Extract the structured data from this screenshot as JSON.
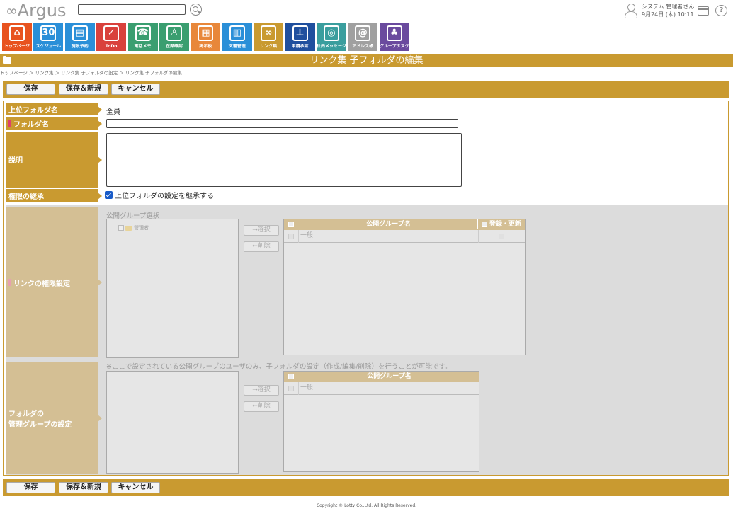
{
  "header": {
    "logo_text": "Argus",
    "logo_mark": "∞",
    "search": {
      "value": "",
      "placeholder": ""
    },
    "user": {
      "name": "システム 管理者さん",
      "datetime": "9月24日 (木) 10:11"
    }
  },
  "apps": [
    {
      "label": "トップページ",
      "color": "#e8531f",
      "icon": "home-icon",
      "glyph": "⌂"
    },
    {
      "label": "スケジュール",
      "color": "#2a8fd8",
      "icon": "calendar-icon",
      "glyph": "30"
    },
    {
      "label": "施設予約",
      "color": "#2a8fd8",
      "icon": "facility-icon",
      "glyph": "▤"
    },
    {
      "label": "ToDo",
      "color": "#d9413c",
      "icon": "todo-icon",
      "glyph": "✓"
    },
    {
      "label": "電話メモ",
      "color": "#3a9e70",
      "icon": "phone-icon",
      "glyph": "☎"
    },
    {
      "label": "在席確認",
      "color": "#3a9e70",
      "icon": "presence-icon",
      "glyph": "♙"
    },
    {
      "label": "掲示板",
      "color": "#e8873a",
      "icon": "board-icon",
      "glyph": "▦"
    },
    {
      "label": "文書管理",
      "color": "#2a8fd8",
      "icon": "document-icon",
      "glyph": "▥"
    },
    {
      "label": "リンク集",
      "color": "#c99a30",
      "icon": "link-icon",
      "glyph": "∞"
    },
    {
      "label": "申請承認",
      "color": "#1f4f9e",
      "icon": "approval-icon",
      "glyph": "⊥"
    },
    {
      "label": "社内メッセージ",
      "color": "#3a9e9e",
      "icon": "message-icon",
      "glyph": "◎"
    },
    {
      "label": "アドレス帳",
      "color": "#a0a0a0",
      "icon": "address-book-icon",
      "glyph": "@"
    },
    {
      "label": "グループタスク",
      "color": "#6a4a9e",
      "icon": "group-task-icon",
      "glyph": "♣"
    }
  ],
  "page": {
    "title": "リンク集 子フォルダの編集",
    "breadcrumb": "トップページ  ＞ リンク集  ＞ リンク集 子フォルダの設定  ＞ リンク集 子フォルダの編集"
  },
  "toolbar": {
    "save": "保存",
    "save_new": "保存＆新規",
    "cancel": "キャンセル"
  },
  "form": {
    "parent_folder": {
      "label": "上位フォルダ名",
      "value": "全員"
    },
    "folder_name": {
      "label": "フォルダ名",
      "value": ""
    },
    "description": {
      "label": "説明",
      "value": ""
    },
    "inherit": {
      "label": "権限の継承",
      "checkbox_label": "上位フォルダの設定を継承する",
      "checked": true
    },
    "link_permission": {
      "label": "リンクの権限設定",
      "group_select_title": "公開グループ選択",
      "tree_item": "管理者",
      "select_button": "→選択",
      "remove_button": "←削除",
      "table": {
        "col_group": "公開グループ名",
        "col_register": "登録・更新",
        "rows": [
          {
            "name": "一般"
          }
        ]
      }
    },
    "admin_group": {
      "label_line1": "フォルダの",
      "label_line2": "管理グループの設定",
      "note": "※ここで設定されている公開グループのユーザのみ、子フォルダの設定（作成/編集/削除）を行うことが可能です。",
      "select_button": "→選択",
      "remove_button": "←削除",
      "table": {
        "col_group": "公開グループ名",
        "rows": [
          {
            "name": "一般"
          }
        ]
      }
    }
  },
  "footer": {
    "copyright": "Copyright © Lotty Co.,Ltd. All Rights Reserved."
  }
}
